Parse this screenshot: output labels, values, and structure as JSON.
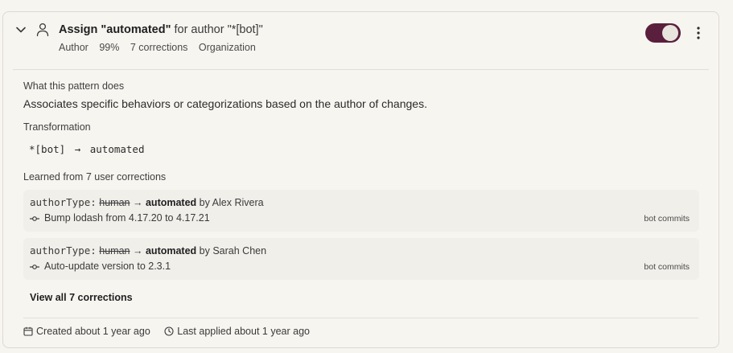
{
  "pattern": {
    "title_prefix": "Assign ",
    "title_value": "\"automated\"",
    "title_suffix": " for author \"*[bot]\"",
    "meta": {
      "type": "Author",
      "confidence": "99%",
      "corrections": "7 corrections",
      "scope": "Organization"
    },
    "enabled": true
  },
  "details": {
    "what_label": "What this pattern does",
    "what_text": "Associates specific behaviors or categorizations based on the author of changes.",
    "transformation_label": "Transformation",
    "transformation_from": "*[bot]",
    "transformation_arrow": "→",
    "transformation_to": "automated",
    "learned_label": "Learned from 7 user corrections"
  },
  "corrections": [
    {
      "field": "authorType:",
      "old": "human",
      "arrow": "→",
      "new": "automated",
      "by_prefix": " by ",
      "author": "Alex Rivera",
      "commit": "Bump lodash from 4.17.20 to 4.17.21",
      "tag": "bot commits"
    },
    {
      "field": "authorType:",
      "old": "human",
      "arrow": "→",
      "new": "automated",
      "by_prefix": " by ",
      "author": "Sarah Chen",
      "commit": "Auto-update version to 2.3.1",
      "tag": "bot commits"
    }
  ],
  "view_all_label": "View all 7 corrections",
  "footer": {
    "created": "Created about 1 year ago",
    "last_applied": "Last applied about 1 year ago"
  },
  "colors": {
    "toggle_on": "#5a1f3c",
    "background": "#f7f5f0",
    "row_bg": "#f1efea"
  },
  "icons": {
    "collapse": "chevron-down-icon",
    "author": "person-icon",
    "menu": "kebab-menu-icon",
    "commit": "git-commit-icon",
    "calendar": "calendar-icon",
    "clock": "clock-icon"
  }
}
